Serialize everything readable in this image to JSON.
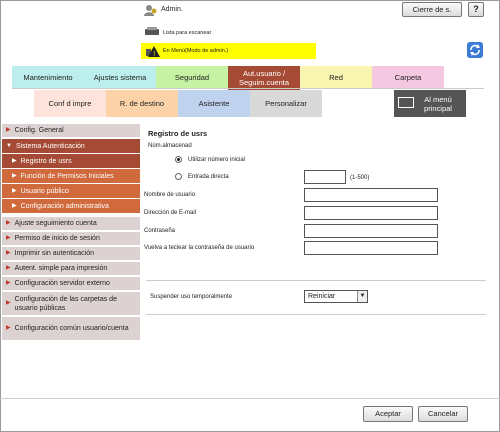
{
  "header": {
    "user_label": "Admin.",
    "logout_label": "Cierre de s.",
    "help_label": "?",
    "scan_list_label": "Lista para escanear",
    "mode_label": "En Menú(Modo de admin.)"
  },
  "tabs_row1": [
    {
      "label": "Mantenimiento",
      "color": "#bdeeee"
    },
    {
      "label": "Ajustes sistema",
      "color": "#bdeeee"
    },
    {
      "label": "Seguridad",
      "color": "#c6f2a4"
    },
    {
      "label": "Aut.usuario / Seguim.cuenta",
      "color": "#a54b35"
    },
    {
      "label": "Red",
      "color": "#f7f5b0"
    },
    {
      "label": "Carpeta",
      "color": "#f5c8e2"
    }
  ],
  "tabs_row2": [
    {
      "label": "Conf d impre",
      "color": "#fde3dc"
    },
    {
      "label": "R. de destino",
      "color": "#fcd3a8"
    },
    {
      "label": "Asistente",
      "color": "#bfd2ee"
    },
    {
      "label": "Personalizar",
      "color": "#d9d9d9"
    },
    {
      "label": "Al menú principal",
      "color": "#555555"
    }
  ],
  "menu": [
    {
      "label": "Config. General"
    },
    {
      "label": "Sistema Autenticación"
    },
    {
      "label": "Registro de usrs"
    },
    {
      "label": "Función de Permisos Iniciales"
    },
    {
      "label": "Usuario público"
    },
    {
      "label": "Configuración administrativa"
    },
    {
      "label": "Ajuste seguimiento cuenta"
    },
    {
      "label": "Permiso de inicio de sesión"
    },
    {
      "label": "Imprimir sin autenticación"
    },
    {
      "label": "Autent. simple para impresión"
    },
    {
      "label": "Configuración servidor externo"
    },
    {
      "label": "Configuración de las carpetas de usuario públicas"
    },
    {
      "label": "Configuración común usuario/cuenta"
    }
  ],
  "form": {
    "title": "Registro de usrs",
    "num_label": "Núm.almacenad",
    "radio_auto": "Utilizar número inicial",
    "radio_direct": "Entrada directa",
    "range_hint": "(1-500)",
    "user_name": "Nombre de usuario",
    "email": "Dirección de E-mail",
    "password": "Contraseña",
    "password_retype": "Vuelva a teclear la contraseña de usuario",
    "suspend_label": "Suspender uso temporalmente",
    "suspend_value": "Reiniciar",
    "ok": "Aceptar",
    "cancel": "Cancelar"
  }
}
